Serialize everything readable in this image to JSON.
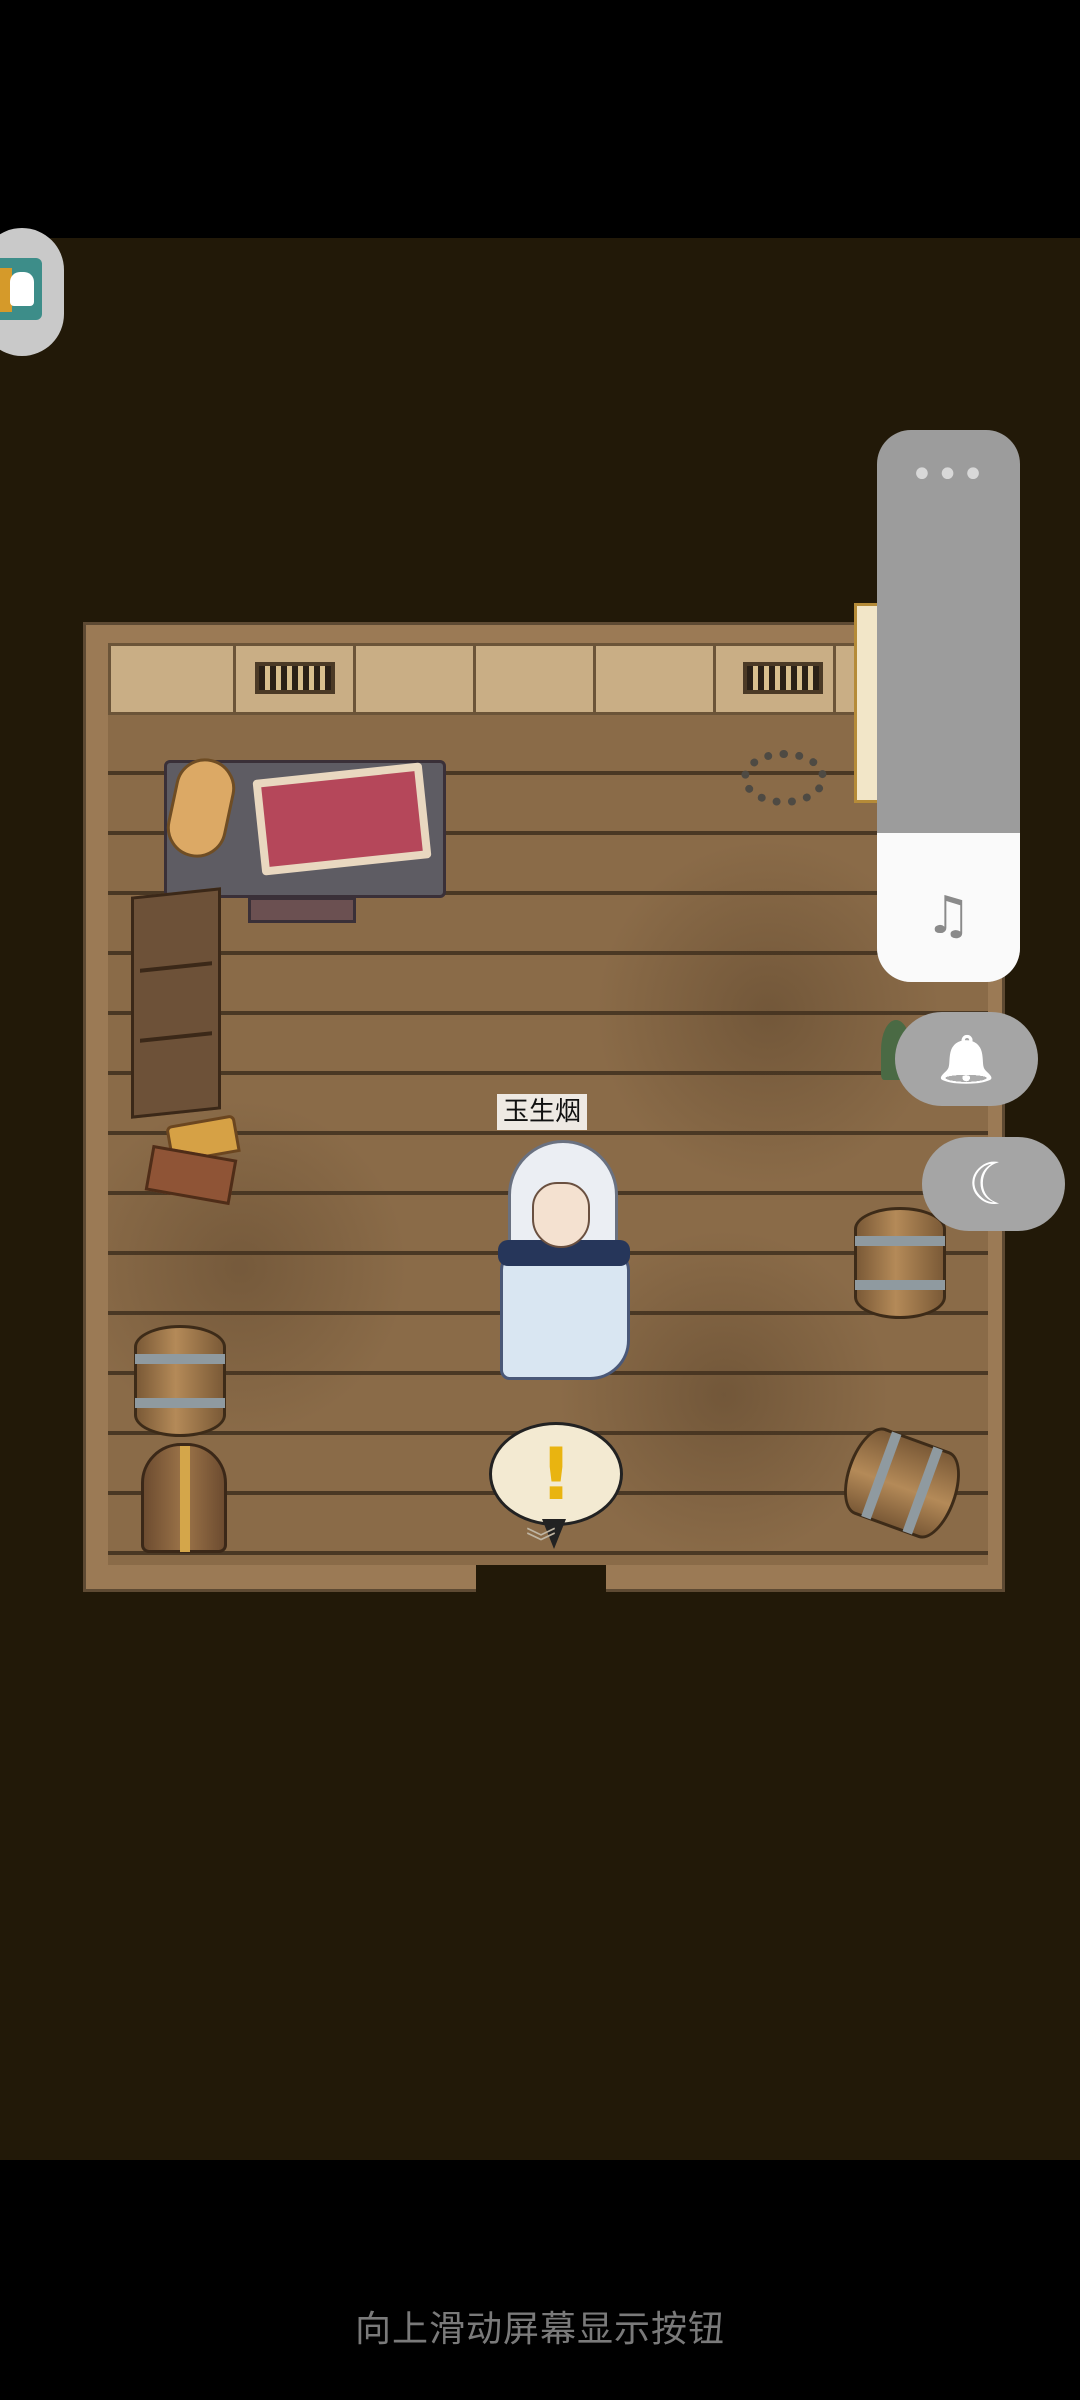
{
  "character": {
    "name": "玉生烟"
  },
  "speech_bubble": {
    "mark": "!"
  },
  "footer": {
    "hint": "向上滑动屏幕显示按钮"
  },
  "volume_panel": {
    "more_glyph": "•••",
    "music_glyph": "♫",
    "level": 0.27
  },
  "side_buttons": {
    "bell_glyph": "🔔",
    "moon_glyph": "☾"
  },
  "chevrons": "︾"
}
